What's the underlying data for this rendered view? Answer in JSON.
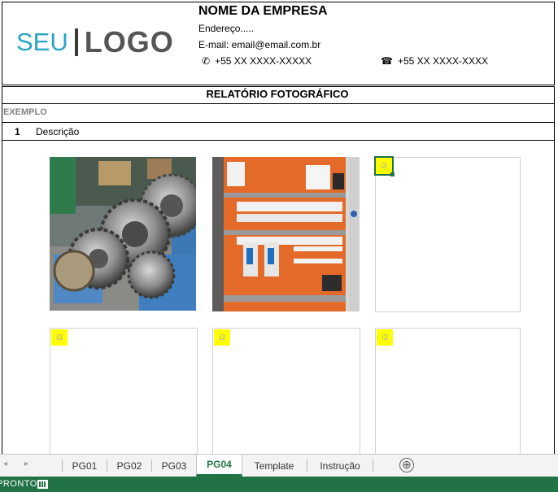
{
  "header": {
    "logo_part1": "SEU",
    "logo_part2": "LOGO",
    "company_name": "NOME DA EMPRESA",
    "address": "Endereço.....",
    "email": "E-mail: email@email.com.br",
    "phone_mobile_icon": "✆",
    "phone_mobile": "+55 XX XXXX-XXXXX",
    "phone_landline_icon": "☎",
    "phone_landline": "+55 XX XXXX-XXXX"
  },
  "report": {
    "title": "RELATÓRIO FOTOGRÁFICO",
    "example_label": "EXEMPLO",
    "item_number": "1",
    "item_description": "Descrição"
  },
  "photos": [
    {
      "kind": "image",
      "subject": "industrial gears"
    },
    {
      "kind": "image",
      "subject": "electrical control panel"
    },
    {
      "kind": "placeholder",
      "label": "i3",
      "selected": true
    },
    {
      "kind": "placeholder",
      "label": "i3"
    },
    {
      "kind": "placeholder",
      "label": "i3"
    },
    {
      "kind": "placeholder",
      "label": "i3"
    }
  ],
  "sheet_tabs": {
    "tabs": [
      "PG01",
      "PG02",
      "PG03",
      "PG04",
      "Template",
      "Instrução"
    ],
    "active": "PG04",
    "add_icon": "⊕"
  },
  "status_bar": {
    "mode": "PRONTO"
  },
  "colors": {
    "excel_green": "#217346",
    "logo_blue": "#2aa3c6",
    "placeholder_yellow": "#ffff00"
  }
}
